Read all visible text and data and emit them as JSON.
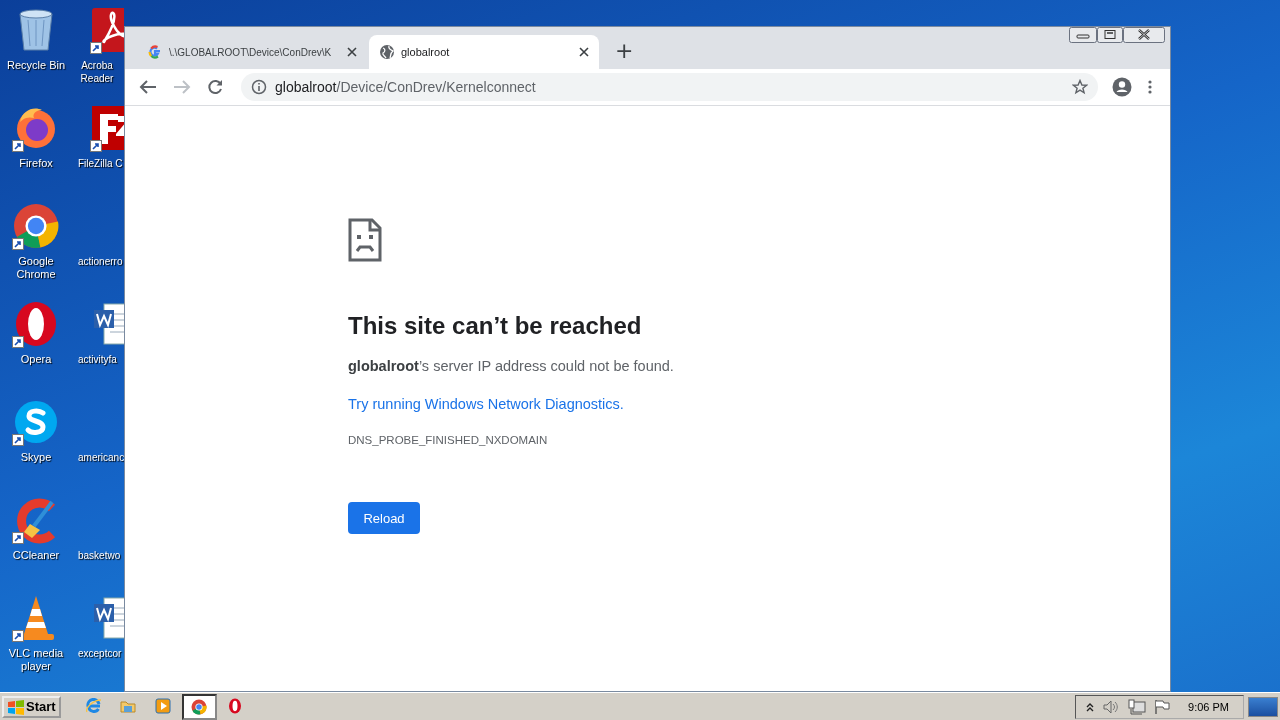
{
  "desktop": {
    "icons": [
      {
        "label": "Recycle Bin",
        "kind": "recycle",
        "shortcut": false
      },
      {
        "label": "Acroba Reader",
        "kind": "acrobat",
        "shortcut": true
      },
      {
        "label": "Firefox",
        "kind": "firefox",
        "shortcut": true
      },
      {
        "label": "FileZilla C",
        "kind": "filezilla",
        "shortcut": true
      },
      {
        "label": "Google Chrome",
        "kind": "chrome",
        "shortcut": true
      },
      {
        "label": "actionerro",
        "kind": "blank",
        "shortcut": false
      },
      {
        "label": "Opera",
        "kind": "opera",
        "shortcut": true
      },
      {
        "label": "activityfa",
        "kind": "word",
        "shortcut": false
      },
      {
        "label": "Skype",
        "kind": "skype",
        "shortcut": true
      },
      {
        "label": "americanc",
        "kind": "blank",
        "shortcut": false
      },
      {
        "label": "CCleaner",
        "kind": "ccleaner",
        "shortcut": true
      },
      {
        "label": "basketwo",
        "kind": "blank",
        "shortcut": false
      },
      {
        "label": "VLC media player",
        "kind": "vlc",
        "shortcut": true
      },
      {
        "label": "exceptcor",
        "kind": "word",
        "shortcut": false
      }
    ]
  },
  "browser": {
    "tabs": [
      {
        "title": "\\.\\GLOBALROOT\\Device\\ConDrev\\K",
        "selected": false
      },
      {
        "title": "globalroot",
        "selected": true
      }
    ],
    "new_tab": "+",
    "toolbar": {
      "back_disabled": false,
      "forward_disabled": true,
      "url_host": "globalroot",
      "url_path": "/Device/ConDrev/Kernelconnect"
    },
    "page": {
      "heading": "This site can’t be reached",
      "message": "**globalroot**’s server IP address could not be found.",
      "link": "Try running Windows Network Diagnostics.",
      "error_code": "DNS_PROBE_FINISHED_NXDOMAIN",
      "button": "Reload"
    }
  },
  "taskbar": {
    "start": "Start",
    "apps": [
      {
        "kind": "ie",
        "selected": false
      },
      {
        "kind": "folder",
        "selected": false
      },
      {
        "kind": "media",
        "selected": false
      },
      {
        "kind": "chrome",
        "selected": true
      },
      {
        "kind": "opera",
        "selected": false
      }
    ],
    "clock": "9:06 PM"
  }
}
